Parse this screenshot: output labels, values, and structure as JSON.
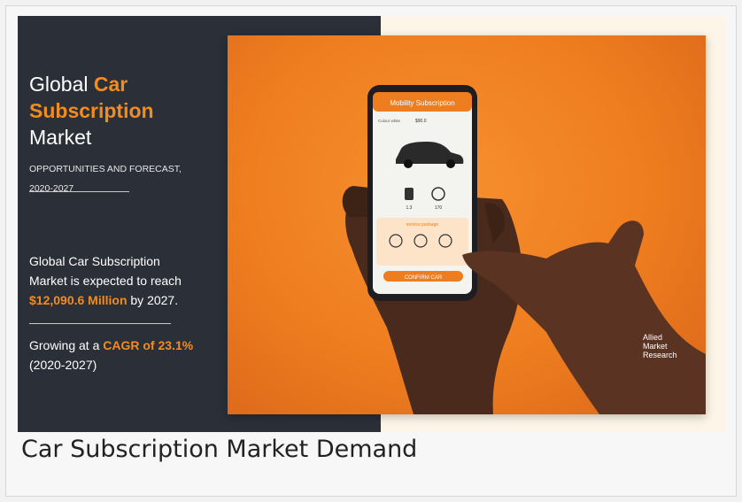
{
  "banner": {
    "title": {
      "line1_plain": "Global ",
      "line1_highlight": "Car",
      "line2_highlight": "Subscription",
      "line3_plain": "Market"
    },
    "subtitle": {
      "line1": "OPPORTUNITIES AND FORECAST,",
      "line2": "2020-2027"
    },
    "stat": {
      "line1": "Global Car Subscription",
      "line2": "Market is expected to reach",
      "value": "$12,090.6 Million",
      "suffix": " by 2027."
    },
    "cagr": {
      "prefix": "Growing at a ",
      "value": "CAGR of 23.1%",
      "period": "(2020-2027)"
    },
    "phone": {
      "app_title": "Mobility Subscription",
      "price_label": "Colour white",
      "price": "$90.0",
      "spec1": "1.3",
      "spec2": "170",
      "section": "service package",
      "confirm": "CONFIRM CAR"
    },
    "logo": {
      "line1": "Allied",
      "line2": "Market",
      "line3": "Research"
    }
  },
  "caption": "Car Subscription Market Demand",
  "colors": {
    "accent": "#f28c1e",
    "panel": "#2b2f37",
    "photo_bg": "#ee7d1f"
  }
}
